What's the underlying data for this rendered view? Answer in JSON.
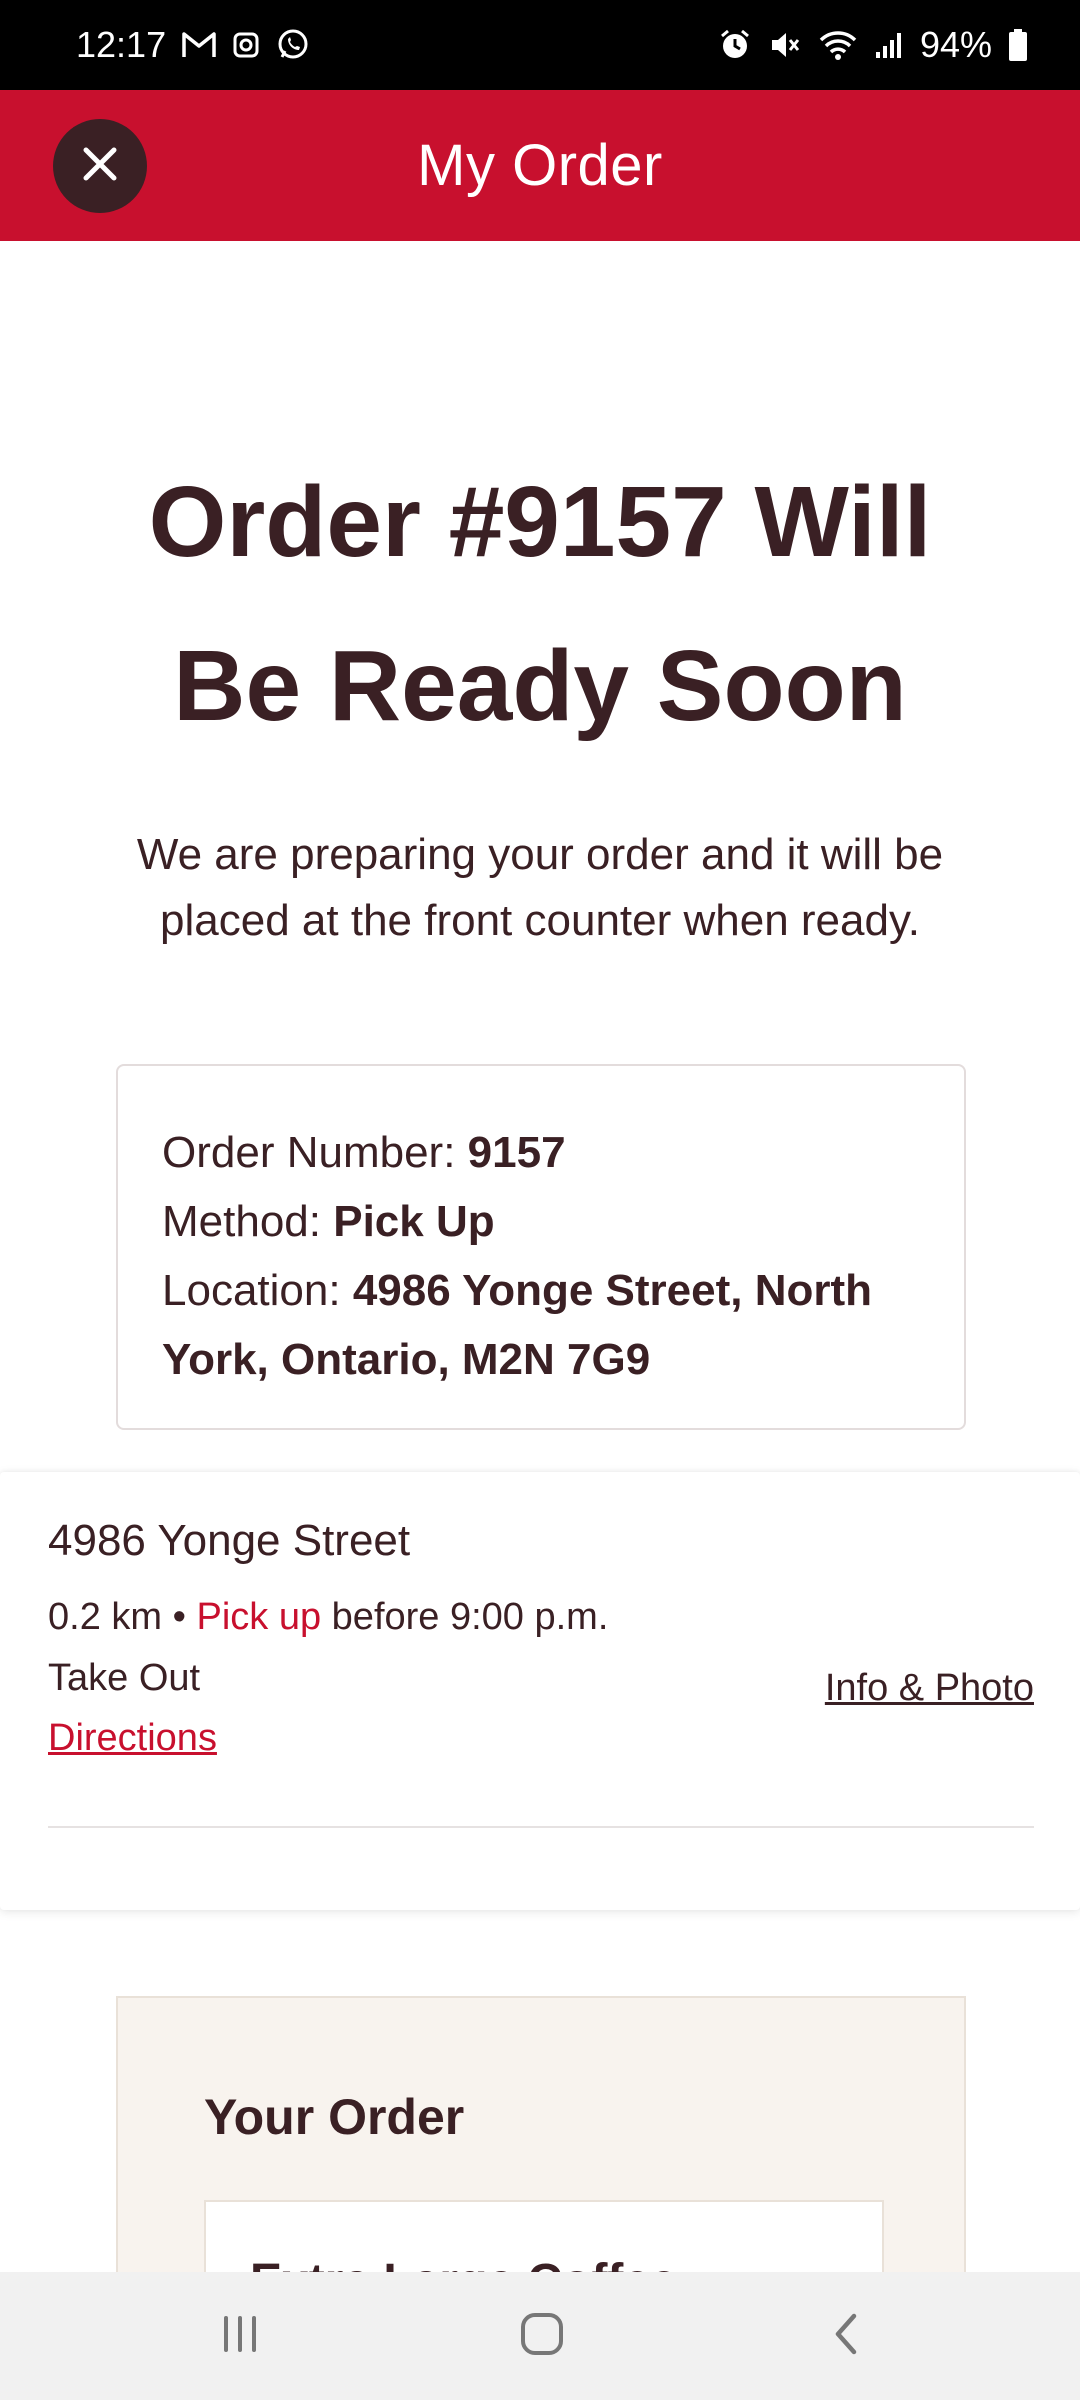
{
  "status_bar": {
    "time": "12:17",
    "battery": "94%",
    "left_icons": [
      "gmail-icon",
      "camera-icon",
      "whatsapp-icon"
    ],
    "right_icons": [
      "alarm-icon",
      "mute-icon",
      "wifi-icon",
      "signal-icon",
      "battery-icon"
    ]
  },
  "header": {
    "title": "My Order",
    "close_icon": "close-icon",
    "background_color": "#c8102e"
  },
  "hero": {
    "title": "Order #9157 Will Be Ready Soon",
    "subtitle": "We are preparing your order and it will be placed at the front counter when ready."
  },
  "order_info": {
    "order_number_label": "Order Number:",
    "order_number": "9157",
    "method_label": "Method:",
    "method": "Pick Up",
    "location_label": "Location:",
    "location": "4986 Yonge Street, North York, Ontario, M2N 7G9"
  },
  "store": {
    "name": "4986 Yonge Street",
    "distance": "0.2 km",
    "separator": "•",
    "pickup_label": "Pick up",
    "pickup_time": "before 9:00 p.m.",
    "service_type": "Take Out",
    "directions_label": "Directions",
    "info_photo_label": "Info & Photo"
  },
  "your_order": {
    "title": "Your Order",
    "first_item": "Extra Large Coffee"
  },
  "nav_bar": {
    "icons": [
      "recents-icon",
      "home-icon",
      "back-icon"
    ]
  },
  "colors": {
    "brand_red": "#c8102e",
    "text_dark": "#3a2024",
    "cream": "#f8f3ee"
  }
}
